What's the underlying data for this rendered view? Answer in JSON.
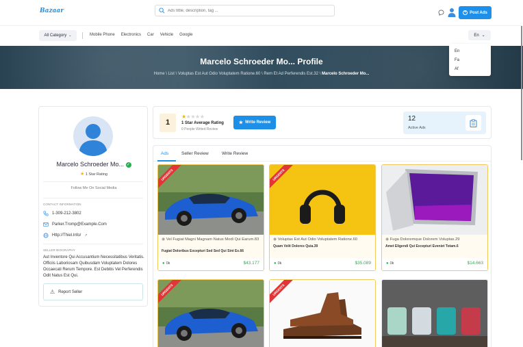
{
  "header": {
    "logo": "Bazaar",
    "search_placeholder": "Ads tittle, description, tag ...",
    "post_ads_label": "Post Ads"
  },
  "nav": {
    "category_label": "All Category",
    "links": [
      "Mobile Phone",
      "Electronics",
      "Car",
      "Vehicle",
      "Google"
    ],
    "language": "En",
    "language_options": [
      "En",
      "Fa",
      "Af"
    ]
  },
  "hero": {
    "title": "Marcelo Schroeder Mo... Profile",
    "breadcrumb": "Home \\ List \\ Voluptas Est Aut Odio Voluptatem Ratione.60 \\ Rem Et Ad Perferendis Est.32 \\",
    "breadcrumb_current": "Marcelo Schroeder Mo..."
  },
  "profile": {
    "name": "Marcelo Schroeder Mo...",
    "rating_label": "1 Star Rating",
    "follow_label": "Follow Me On Social Media",
    "contact_title": "CONTACT INFORMATION",
    "phone": "1-309-212-3802",
    "email": "Parker.Tromp@Example.Com",
    "website": "Http://Thiel.Info/",
    "bio_title": "SELLER BIOGRAPHY",
    "bio": "Aut Inventore Qui Accusantium Necessitatibus Veritatis. Officiis Laboriosam Quibusdam Voluptatem Dolores Occaecati Rerum Tempore. Est Debitis Vel Perferendis Odit Natus Est Qui.",
    "report_label": "Report Seller"
  },
  "stats": {
    "rating_value": "1",
    "stars_filled": 1,
    "stars_total": 5,
    "average_label": "1 Star Average Rating",
    "written_label": "0 People Writed Review",
    "write_review_label": "Write Review",
    "active_count": "12",
    "active_label": "Active Ads"
  },
  "tabs": [
    "Ads",
    "Seller Review",
    "Write Review"
  ],
  "ads": [
    {
      "badge": "URGENTS",
      "title": "Vel Fugiat Magni Magnam Natus Modi Qui Earum.83",
      "subtitle": "Fugiat Doloribus Excepturi Sed Sed Qui Sint Ex.66",
      "location": "0k",
      "price": "$43.177",
      "image": "car"
    },
    {
      "badge": "URGENTS",
      "title": "Voluptas Est Aut Odio Voluptatem Ratione.60",
      "subtitle": "Quam Velit Dolores Quia.39",
      "location": "0k",
      "price": "$35.089",
      "image": "headphones"
    },
    {
      "badge": "",
      "title": "Fuga Doloremque Dolorem Voluptas.29",
      "subtitle": "Amet Eligendi Qui Excepturi Eveniet Totam.6",
      "location": "0k",
      "price": "$14.663",
      "image": "laptop"
    },
    {
      "badge": "URGENTS",
      "title": "",
      "subtitle": "",
      "location": "",
      "price": "",
      "image": "car"
    },
    {
      "badge": "URGENTS",
      "title": "",
      "subtitle": "",
      "location": "",
      "price": "",
      "image": "shoes"
    },
    {
      "badge": "",
      "title": "",
      "subtitle": "",
      "location": "",
      "price": "",
      "image": "mugs"
    }
  ],
  "colors": {
    "accent": "#1e8fe6",
    "price": "#27b24a",
    "star": "#f5b400",
    "badge": "#e23636"
  }
}
